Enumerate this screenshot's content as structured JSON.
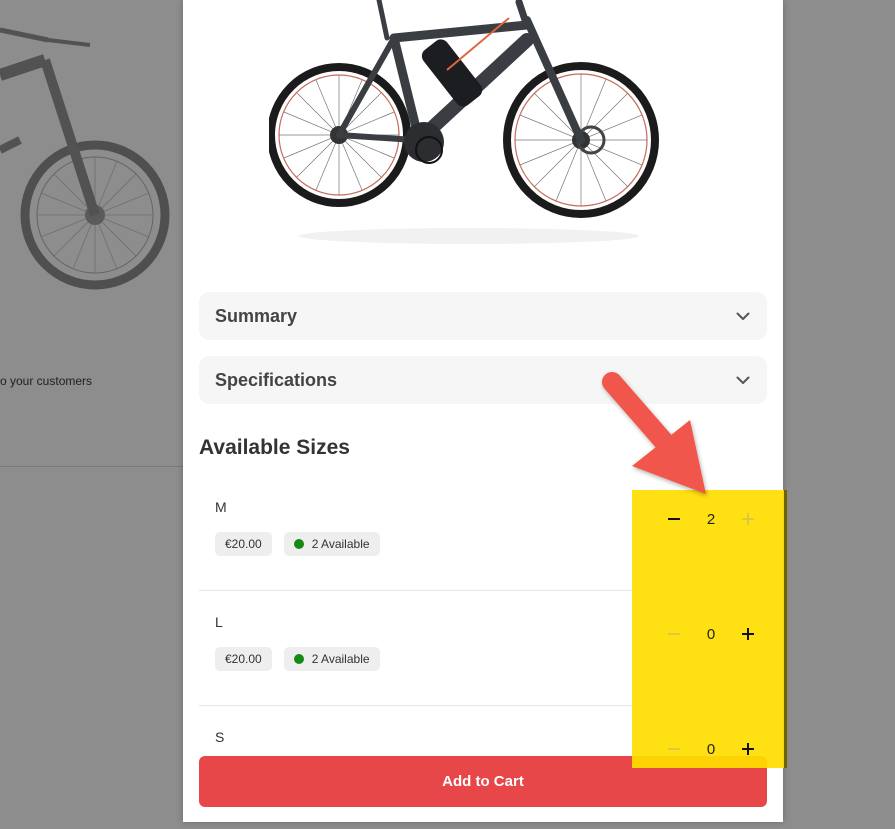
{
  "background": {
    "partial_text": "o your customers"
  },
  "modal": {
    "accordions": [
      {
        "title": "Summary"
      },
      {
        "title": "Specifications"
      }
    ],
    "sizes_title": "Available Sizes",
    "sizes": [
      {
        "label": "M",
        "price": "€20.00",
        "availability": "2 Available",
        "quantity": "2"
      },
      {
        "label": "L",
        "price": "€20.00",
        "availability": "2 Available",
        "quantity": "0"
      },
      {
        "label": "S",
        "price": "",
        "availability": "",
        "quantity": "0"
      }
    ],
    "add_to_cart_label": "Add to Cart"
  },
  "icons": {
    "accordion": "chevron-down-icon",
    "decrement": "minus-icon",
    "increment": "plus-icon",
    "availability": "status-dot-icon"
  },
  "colors": {
    "accent": "#e8474a",
    "available_dot": "#138a13",
    "highlight": "#ffde00",
    "annotation_arrow": "#f0574b"
  }
}
